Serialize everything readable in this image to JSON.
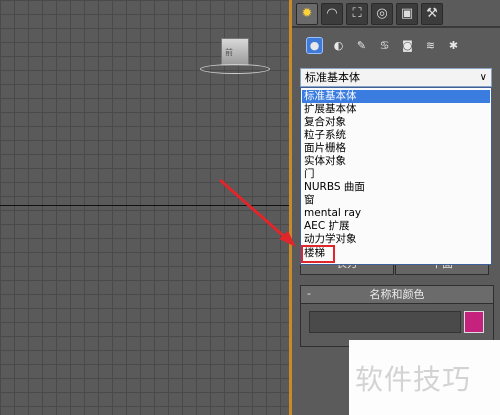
{
  "viewport": {
    "cube_label": "前"
  },
  "panel": {
    "tabs": [
      {
        "name": "create",
        "glyph": "✹"
      },
      {
        "name": "modify",
        "glyph": "◠"
      },
      {
        "name": "hierarchy",
        "glyph": "⛶"
      },
      {
        "name": "motion",
        "glyph": "◎"
      },
      {
        "name": "display",
        "glyph": "▣"
      },
      {
        "name": "utilities",
        "glyph": "⚒"
      }
    ],
    "categories": [
      {
        "name": "geometry",
        "glyph": "●"
      },
      {
        "name": "shapes",
        "glyph": "◐"
      },
      {
        "name": "lights",
        "glyph": "✎"
      },
      {
        "name": "cameras",
        "glyph": "♋"
      },
      {
        "name": "helpers",
        "glyph": "◙"
      },
      {
        "name": "space-warps",
        "glyph": "≋"
      },
      {
        "name": "systems",
        "glyph": "✱"
      }
    ],
    "dropdown": {
      "value": "标准基本体",
      "arrow": "∨"
    },
    "list_options": [
      "标准基本体",
      "扩展基本体",
      "复合对象",
      "粒子系统",
      "面片栅格",
      "实体对象",
      "门",
      "NURBS 曲面",
      "窗",
      "mental ray",
      "AEC 扩展",
      "动力学对象",
      "楼梯"
    ],
    "selected_option": "标准基本体",
    "buttons": {
      "box": "长方",
      "plane": "平面"
    },
    "rollout": {
      "title": "名称和颜色",
      "collapse": "-",
      "name_value": "",
      "color": "#c4227c"
    }
  },
  "watermark": "软件技巧"
}
